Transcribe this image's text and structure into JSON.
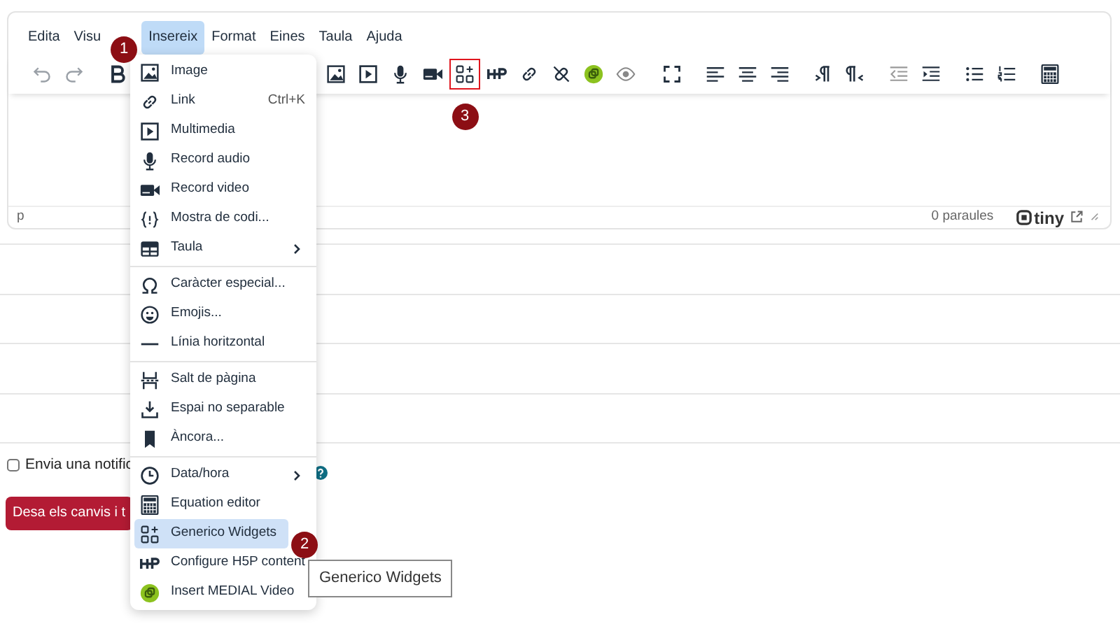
{
  "menubar": [
    {
      "label": "Edita",
      "selected": false
    },
    {
      "label": "Visu",
      "selected": false
    },
    {
      "label": "Insereix",
      "selected": true
    },
    {
      "label": "Format",
      "selected": false
    },
    {
      "label": "Eines",
      "selected": false
    },
    {
      "label": "Taula",
      "selected": false
    },
    {
      "label": "Ajuda",
      "selected": false
    }
  ],
  "toolbar_left": [
    {
      "kind": "undo",
      "disabled": true
    },
    {
      "kind": "redo",
      "disabled": true
    },
    {
      "kind": "bold",
      "disabled": false
    }
  ],
  "toolbar_right": [
    {
      "kind": "image",
      "highlighted": false
    },
    {
      "kind": "media",
      "highlighted": false
    },
    {
      "kind": "mic",
      "highlighted": false
    },
    {
      "kind": "video",
      "highlighted": false
    },
    {
      "kind": "widgets",
      "highlighted": true
    },
    {
      "kind": "h5p",
      "highlighted": false
    },
    {
      "kind": "link",
      "highlighted": false
    },
    {
      "kind": "unlink",
      "highlighted": false
    },
    {
      "kind": "medial",
      "highlighted": false
    },
    {
      "kind": "eye",
      "highlighted": false
    },
    {
      "kind": "fullscreen",
      "highlighted": false
    },
    {
      "kind": "alignleft",
      "highlighted": false
    },
    {
      "kind": "aligncenter",
      "highlighted": false
    },
    {
      "kind": "alignright",
      "highlighted": false
    },
    {
      "kind": "ltr",
      "highlighted": false
    },
    {
      "kind": "rtl",
      "highlighted": false
    },
    {
      "kind": "outdent",
      "highlighted": false
    },
    {
      "kind": "indent",
      "highlighted": false
    },
    {
      "kind": "bullist",
      "highlighted": false
    },
    {
      "kind": "numlist",
      "highlighted": false
    },
    {
      "kind": "calculator",
      "highlighted": false
    }
  ],
  "status_bar": {
    "path": "p",
    "word_count": "0 paraules",
    "logo_text": "tiny"
  },
  "insert_menu": {
    "groups": [
      [
        {
          "kind": "image",
          "label": "Image",
          "selected": false
        },
        {
          "kind": "link",
          "label": "Link",
          "shortcut": "Ctrl+K",
          "selected": false
        },
        {
          "kind": "media",
          "label": "Multimedia",
          "selected": false
        },
        {
          "kind": "mic",
          "label": "Record audio",
          "selected": false
        },
        {
          "kind": "video",
          "label": "Record video",
          "selected": false
        },
        {
          "kind": "code",
          "label": "Mostra de codi...",
          "selected": false
        },
        {
          "kind": "table",
          "label": "Taula",
          "submenu": true,
          "selected": false
        }
      ],
      [
        {
          "kind": "omega",
          "label": "Caràcter especial...",
          "selected": false
        },
        {
          "kind": "emoji",
          "label": "Emojis...",
          "selected": false
        },
        {
          "kind": "hr",
          "label": "Línia horitzontal",
          "selected": false
        }
      ],
      [
        {
          "kind": "pagebreak",
          "label": "Salt de pàgina",
          "selected": false
        },
        {
          "kind": "nbsp",
          "label": "Espai no separable",
          "selected": false
        },
        {
          "kind": "bookmark",
          "label": "Àncora...",
          "selected": false
        }
      ],
      [
        {
          "kind": "clock",
          "label": "Data/hora",
          "submenu": true,
          "selected": false
        },
        {
          "kind": "calculator",
          "label": "Equation editor",
          "selected": false
        },
        {
          "kind": "widgets",
          "label": "Generico Widgets",
          "selected": true
        },
        {
          "kind": "h5p",
          "label": "Configure H5P content",
          "selected": false
        },
        {
          "kind": "medial",
          "label": "Insert MEDIAL Video",
          "selected": false
        }
      ]
    ]
  },
  "notify_checkbox": {
    "label": "Envia una notific",
    "checked": false
  },
  "save_button": {
    "label": "Desa els canvis i t"
  },
  "tooltip": {
    "text": "Generico Widgets"
  },
  "step_badges": [
    {
      "number": "1"
    },
    {
      "number": "2"
    },
    {
      "number": "3"
    }
  ]
}
